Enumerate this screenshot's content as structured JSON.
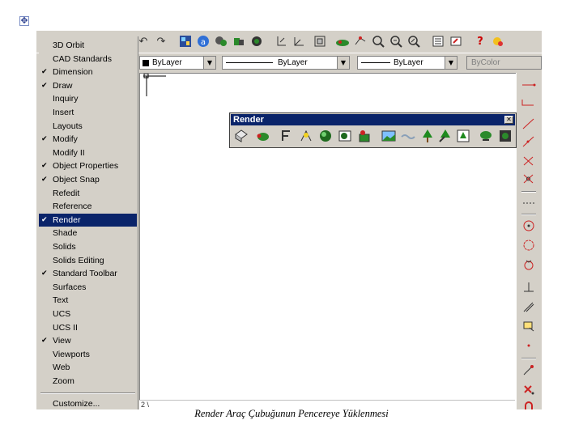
{
  "toolbar_menu": {
    "items": [
      {
        "label": "3D Orbit",
        "checked": false
      },
      {
        "label": "CAD Standards",
        "checked": false
      },
      {
        "label": "Dimension",
        "checked": true
      },
      {
        "label": "Draw",
        "checked": true
      },
      {
        "label": "Inquiry",
        "checked": false
      },
      {
        "label": "Insert",
        "checked": false
      },
      {
        "label": "Layouts",
        "checked": false
      },
      {
        "label": "Modify",
        "checked": true
      },
      {
        "label": "Modify II",
        "checked": false
      },
      {
        "label": "Object Properties",
        "checked": true
      },
      {
        "label": "Object Snap",
        "checked": true
      },
      {
        "label": "Refedit",
        "checked": false
      },
      {
        "label": "Reference",
        "checked": false
      },
      {
        "label": "Render",
        "checked": true,
        "selected": true
      },
      {
        "label": "Shade",
        "checked": false
      },
      {
        "label": "Solids",
        "checked": false
      },
      {
        "label": "Solids Editing",
        "checked": false
      },
      {
        "label": "Standard Toolbar",
        "checked": true
      },
      {
        "label": "Surfaces",
        "checked": false
      },
      {
        "label": "Text",
        "checked": false
      },
      {
        "label": "UCS",
        "checked": false
      },
      {
        "label": "UCS II",
        "checked": false
      },
      {
        "label": "View",
        "checked": true
      },
      {
        "label": "Viewports",
        "checked": false
      },
      {
        "label": "Web",
        "checked": false
      },
      {
        "label": "Zoom",
        "checked": false
      }
    ],
    "customize_label": "Customize...",
    "check_glyph": "✔"
  },
  "properties": {
    "color_value": "ByLayer",
    "linetype_value": "ByLayer",
    "lineweight_value": "ByLayer",
    "plotstyle_value": "ByColor"
  },
  "render_toolbar": {
    "title": "Render",
    "close_glyph": "✕"
  },
  "status": {
    "coord_fragment": "2 \\"
  },
  "caption": "Render Araç Çubuğunun Pencereye Yüklenmesi",
  "icons": {
    "standard": [
      "undo-icon",
      "redo-icon",
      "design-center-icon",
      "properties-icon",
      "tool-palettes-icon",
      "pan-icon",
      "zoom-realtime-icon",
      "zoom-window-icon",
      "zoom-previous-icon",
      "distance-icon",
      "ucs-icon",
      "named-views-icon",
      "3d-orbit-icon",
      "camera-icon",
      "help-icon",
      "today-icon"
    ],
    "render": [
      "hide-icon",
      "render-icon",
      "scenes-icon",
      "lights-icon",
      "materials-icon",
      "materials-library-icon",
      "mapping-icon",
      "background-icon",
      "fog-icon",
      "new-landscape-icon",
      "edit-landscape-icon",
      "landscape-library-icon",
      "render-preferences-icon",
      "statistics-icon",
      "save-image-icon"
    ],
    "modify": [
      "line-icon",
      "construction-line-icon",
      "polyline-icon",
      "polygon-icon",
      "rectangle-icon",
      "arc-icon",
      "circle-icon",
      "revision-cloud-icon",
      "spline-icon",
      "ellipse-icon",
      "insert-block-icon",
      "point-icon",
      "hatch-icon"
    ]
  },
  "colors": {
    "chrome": "#d4d0c8",
    "selection": "#0a246a",
    "title_bar": "#0a246a",
    "canvas": "#ffffff"
  }
}
